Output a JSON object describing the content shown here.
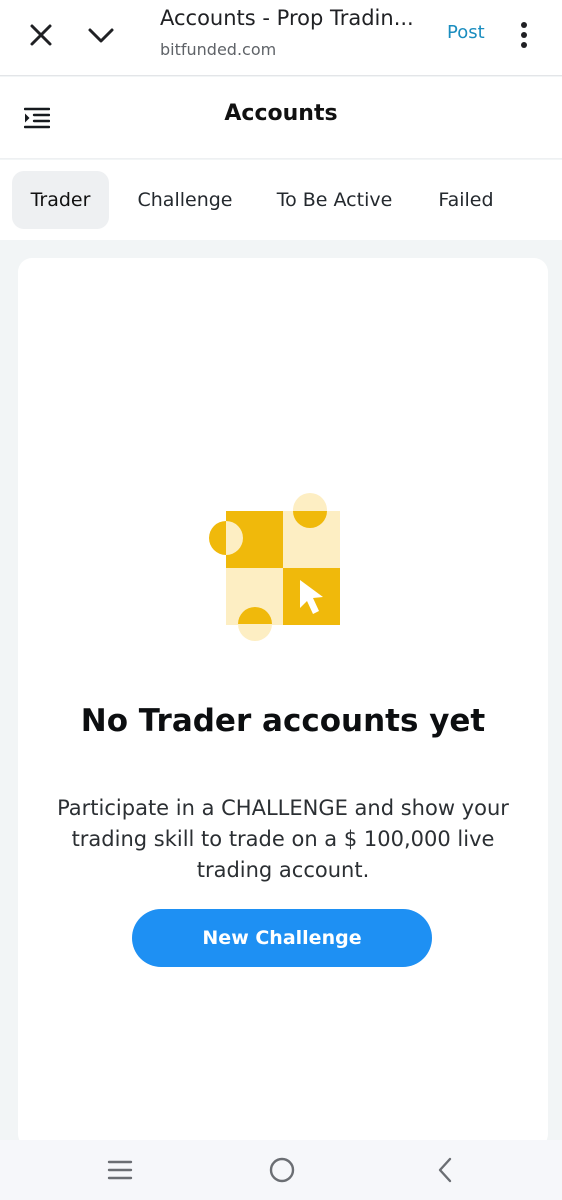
{
  "browser": {
    "title": "Accounts - Prop Tradin...",
    "url": "bitfunded.com",
    "post_label": "Post",
    "icons": [
      "close-icon",
      "chevron-down-icon",
      "more-vertical-icon"
    ]
  },
  "header": {
    "title": "Accounts",
    "menu_icon": "menu-collapse-icon"
  },
  "tabs": [
    {
      "label": "Trader",
      "active": true
    },
    {
      "label": "Challenge",
      "active": false
    },
    {
      "label": "To Be Active",
      "active": false
    },
    {
      "label": "Failed",
      "active": false
    }
  ],
  "empty_state": {
    "illustration": "checkerboard-cursor-icon",
    "title": "No Trader accounts yet",
    "description": "Participate in a CHALLENGE and show your trading skill to trade on a $ 100,000 live trading account.",
    "button_label": "New Challenge"
  },
  "nav_bar": {
    "icons": [
      "recent-apps-icon",
      "home-icon",
      "back-icon"
    ]
  },
  "colors": {
    "accent_blue": "#1e90f3",
    "link_blue": "#1a8dbf",
    "yellow_dark": "#f0b90b",
    "yellow_light": "#fdeec3",
    "page_bg": "#f2f5f6"
  }
}
